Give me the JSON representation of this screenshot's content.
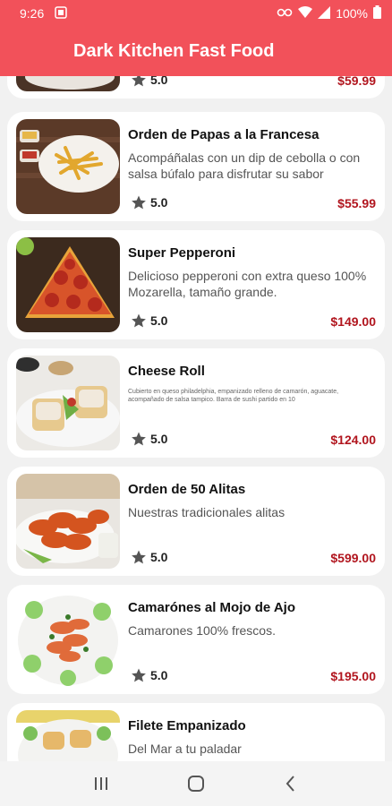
{
  "status_bar": {
    "time": "9:26",
    "battery": "100%"
  },
  "app_bar": {
    "title": "Dark Kitchen Fast Food"
  },
  "colors": {
    "primary": "#f2515a",
    "price": "#b1151e",
    "card": "#ffffff",
    "background": "#f1f1f1"
  },
  "products": [
    {
      "name": "",
      "description": "",
      "rating": "5.0",
      "price": "$59.99"
    },
    {
      "name": "Orden de Papas a la Francesa",
      "description": "Acompáñalas con un dip de cebolla o con salsa búfalo para disfrutar su sabor",
      "rating": "5.0",
      "price": "$55.99"
    },
    {
      "name": "Super Pepperoni",
      "description": "Delicioso pepperoni con extra queso 100% Mozarella, tamaño grande.",
      "rating": "5.0",
      "price": "$149.00"
    },
    {
      "name": "Cheese Roll",
      "description": "Cubierto en queso philadelphia, empanizado relleno de camarón, aguacate, acompañado de salsa tampico. Barra de sushi partido en 10",
      "rating": "5.0",
      "price": "$124.00"
    },
    {
      "name": "Orden de 50 Alitas",
      "description": "Nuestras tradicionales alitas",
      "rating": "5.0",
      "price": "$599.00"
    },
    {
      "name": "Camarónes al Mojo de Ajo",
      "description": "Camarones 100% frescos.",
      "rating": "5.0",
      "price": "$195.00"
    },
    {
      "name": "Filete Empanizado",
      "description": "Del Mar a tu paladar",
      "rating": "",
      "price": ""
    }
  ],
  "icons": {
    "rating": "star-icon",
    "nav": [
      "recent-apps-icon",
      "home-icon",
      "back-icon"
    ]
  }
}
